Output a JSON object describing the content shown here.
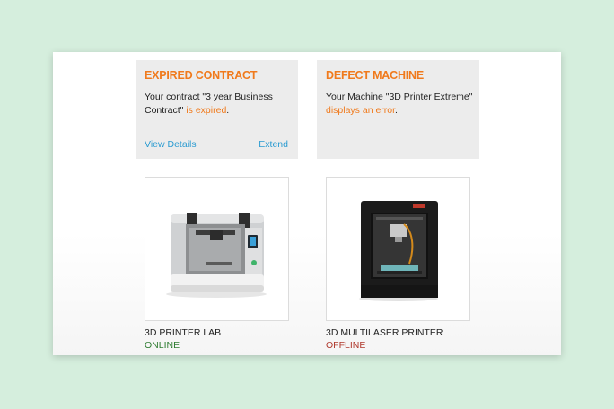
{
  "cards": [
    {
      "title": "EXPIRED CONTRACT",
      "body_text": "Your contract \"3 year Business Contract\"",
      "body_highlight": "is expired",
      "body_end": ".",
      "link_left": "View Details",
      "link_right": "Extend"
    },
    {
      "title": "DEFECT MACHINE",
      "body_text": "Your Machine \"3D Printer Extreme\"",
      "body_highlight": "displays an error",
      "body_end": "."
    }
  ],
  "products": [
    {
      "name": "3D PRINTER LAB",
      "status": "ONLINE",
      "status_color": "#2f7d32"
    },
    {
      "name": "3D MULTILASER PRINTER",
      "status": "OFFLINE",
      "status_color": "#b03a2e"
    }
  ],
  "colors": {
    "accent": "#f07a1c",
    "link": "#2a9bd1",
    "card_bg": "#ececec",
    "page_bg": "#d5eedd"
  }
}
